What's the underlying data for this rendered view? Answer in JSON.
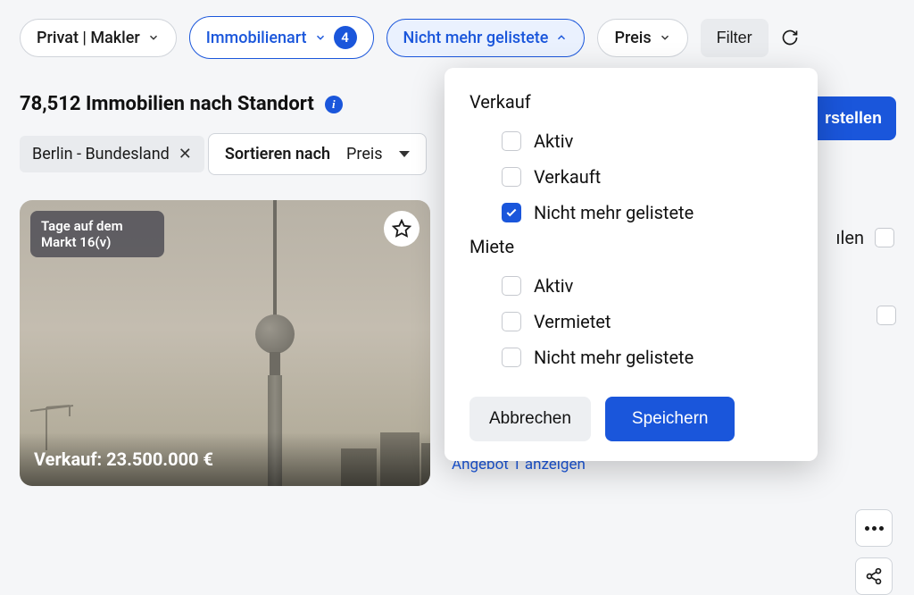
{
  "filter_bar": {
    "owner_type": "Privat | Makler",
    "property_type": "Immobilienart",
    "property_type_count": "4",
    "delisted": "Nicht mehr gelistete",
    "price": "Preis",
    "filter_label": "Filter"
  },
  "heading": {
    "text": "78,512 Immobilien nach Standort",
    "info_glyph": "i"
  },
  "location_chip": {
    "label": "Berlin - Bundesland",
    "close_glyph": "✕"
  },
  "sort": {
    "label": "Sortieren nach",
    "value": "Preis"
  },
  "card": {
    "days_badge": "Tage auf dem Markt 16(v)",
    "price_text": "Verkauf: 23.500.000 €"
  },
  "right": {
    "create_partial": "rstellen",
    "count_partial": "ılen",
    "offer_link": "Angebot 1 anzeigen"
  },
  "dropdown": {
    "group_sale": "Verkauf",
    "group_rent": "Miete",
    "sale_active": {
      "label": "Aktiv",
      "checked": false
    },
    "sale_sold": {
      "label": "Verkauft",
      "checked": false
    },
    "sale_delisted": {
      "label": "Nicht mehr gelistete",
      "checked": true
    },
    "rent_active": {
      "label": "Aktiv",
      "checked": false
    },
    "rent_rented": {
      "label": "Vermietet",
      "checked": false
    },
    "rent_delisted": {
      "label": "Nicht mehr gelistete",
      "checked": false
    },
    "cancel": "Abbrechen",
    "save": "Speichern"
  }
}
